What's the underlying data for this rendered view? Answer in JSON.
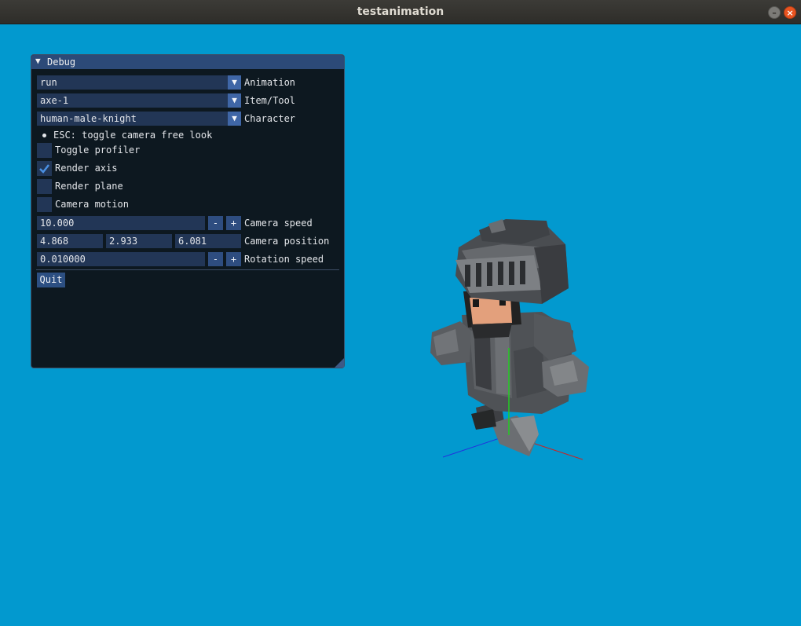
{
  "window": {
    "title": "testanimation",
    "minimize_label": "–",
    "close_label": "×"
  },
  "colors": {
    "background": "#0299cf",
    "panel": "#0d141a",
    "header": "#2c4a78",
    "frame": "#223656",
    "button": "#2e4d80",
    "check": "#4a90e2"
  },
  "debug": {
    "title": "Debug",
    "collapse_icon": "▼",
    "animation": {
      "value": "run",
      "label": "Animation"
    },
    "item_tool": {
      "value": "axe-1",
      "label": "Item/Tool"
    },
    "character": {
      "value": "human-male-knight",
      "label": "Character"
    },
    "hint": "ESC: toggle camera free look",
    "toggle_profiler": {
      "label": "Toggle profiler",
      "checked": false
    },
    "render_axis": {
      "label": "Render axis",
      "checked": true
    },
    "render_plane": {
      "label": "Render plane",
      "checked": false
    },
    "camera_motion": {
      "label": "Camera motion",
      "checked": false
    },
    "camera_speed": {
      "value": "10.000",
      "label": "Camera speed",
      "minus": "-",
      "plus": "+"
    },
    "camera_position": {
      "x": "4.868",
      "y": "2.933",
      "z": "6.081",
      "label": "Camera position"
    },
    "rotation_speed": {
      "value": "0.010000",
      "label": "Rotation speed",
      "minus": "-",
      "plus": "+"
    },
    "quit_label": "Quit"
  }
}
